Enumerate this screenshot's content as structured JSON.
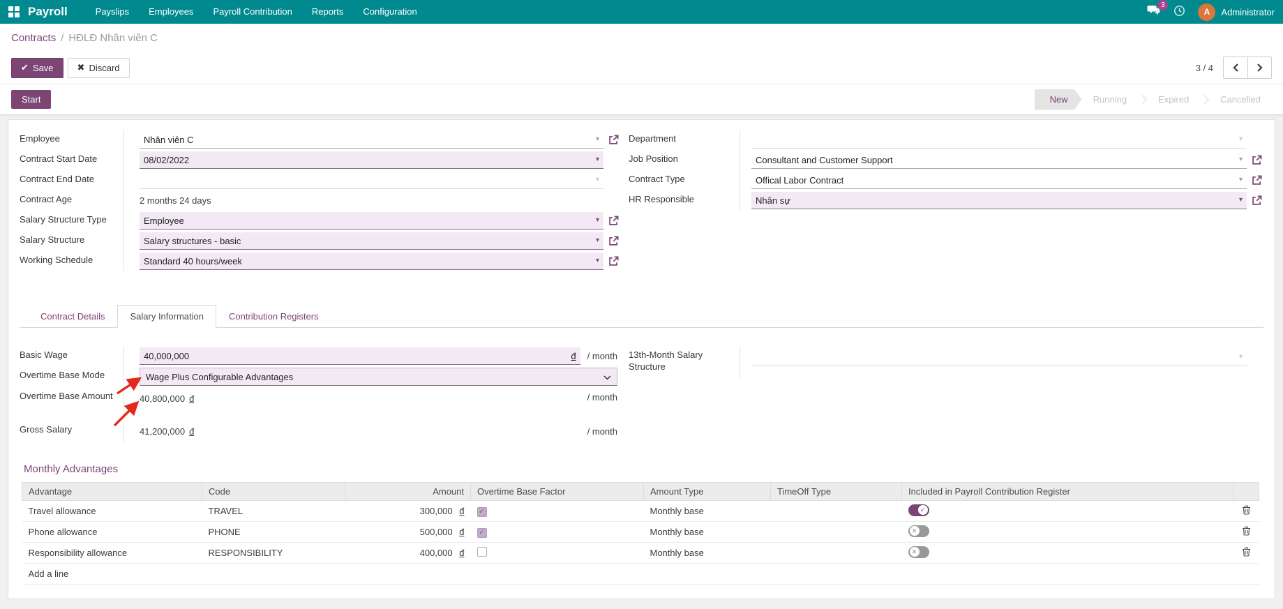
{
  "colors": {
    "accent": "#7c4576",
    "navbar": "#00898e",
    "field_bg": "#f3e9f5",
    "badge": "#a8438f",
    "avatar": "#d9763c",
    "annotation_arrow": "#e5281b"
  },
  "navbar": {
    "brand": "Payroll",
    "menus": [
      {
        "label": "Payslips"
      },
      {
        "label": "Employees"
      },
      {
        "label": "Payroll Contribution"
      },
      {
        "label": "Reports"
      },
      {
        "label": "Configuration"
      }
    ],
    "message_badge": "3",
    "user_name": "Administrator",
    "avatar_initial": "A"
  },
  "breadcrumb": {
    "parent": "Contracts",
    "separator": "/",
    "current": "HĐLĐ Nhân viên C"
  },
  "actions": {
    "save": "Save",
    "discard": "Discard",
    "pager": "3 / 4"
  },
  "statusbar": {
    "start": "Start",
    "steps": [
      {
        "label": "New",
        "active": true
      },
      {
        "label": "Running",
        "active": false
      },
      {
        "label": "Expired",
        "active": false
      },
      {
        "label": "Cancelled",
        "active": false
      }
    ]
  },
  "form": {
    "left": {
      "employee": {
        "label": "Employee",
        "value": "Nhân viên C"
      },
      "start_date": {
        "label": "Contract Start Date",
        "value": "08/02/2022"
      },
      "end_date": {
        "label": "Contract End Date",
        "value": ""
      },
      "age": {
        "label": "Contract Age",
        "value": "2 months 24 days"
      },
      "sst": {
        "label": "Salary Structure Type",
        "value": "Employee"
      },
      "ss": {
        "label": "Salary Structure",
        "value": "Salary structures - basic"
      },
      "ws": {
        "label": "Working Schedule",
        "value": "Standard 40 hours/week"
      }
    },
    "right": {
      "department": {
        "label": "Department",
        "value": ""
      },
      "job": {
        "label": "Job Position",
        "value": "Consultant and Customer Support"
      },
      "ctype": {
        "label": "Contract Type",
        "value": "Offical Labor Contract"
      },
      "hr": {
        "label": "HR Responsible",
        "value": "Nhân sự"
      }
    }
  },
  "tabs": [
    {
      "label": "Contract Details",
      "active": false
    },
    {
      "label": "Salary Information",
      "active": true
    },
    {
      "label": "Contribution Registers",
      "active": false
    }
  ],
  "salary": {
    "basic_wage": {
      "label": "Basic Wage",
      "value": "40,000,000",
      "currency": "đ",
      "per": "/ month"
    },
    "overtime_mode": {
      "label": "Overtime Base Mode",
      "value": "Wage Plus Configurable Advantages"
    },
    "overtime_amount": {
      "label": "Overtime Base Amount",
      "value": "40,800,000",
      "currency": "đ",
      "per": "/ month"
    },
    "gross": {
      "label": "Gross Salary",
      "value": "41,200,000",
      "currency": "đ",
      "per": "/ month"
    },
    "thirteenth": {
      "label": "13th-Month Salary Structure",
      "value": ""
    }
  },
  "monthly_advantages": {
    "title": "Monthly Advantages",
    "columns": [
      "Advantage",
      "Code",
      "Amount",
      "Overtime Base Factor",
      "Amount Type",
      "TimeOff Type",
      "Included in Payroll Contribution Register"
    ],
    "rows": [
      {
        "advantage": "Travel allowance",
        "code": "TRAVEL",
        "amount": "300,000",
        "currency": "đ",
        "overtime_base_factor": true,
        "amount_type": "Monthly base",
        "timeoff_type": "",
        "included_in_register": true
      },
      {
        "advantage": "Phone allowance",
        "code": "PHONE",
        "amount": "500,000",
        "currency": "đ",
        "overtime_base_factor": true,
        "amount_type": "Monthly base",
        "timeoff_type": "",
        "included_in_register": false
      },
      {
        "advantage": "Responsibility allowance",
        "code": "RESPONSIBILITY",
        "amount": "400,000",
        "currency": "đ",
        "overtime_base_factor": false,
        "amount_type": "Monthly base",
        "timeoff_type": "",
        "included_in_register": false
      }
    ],
    "add_line": "Add a line"
  }
}
